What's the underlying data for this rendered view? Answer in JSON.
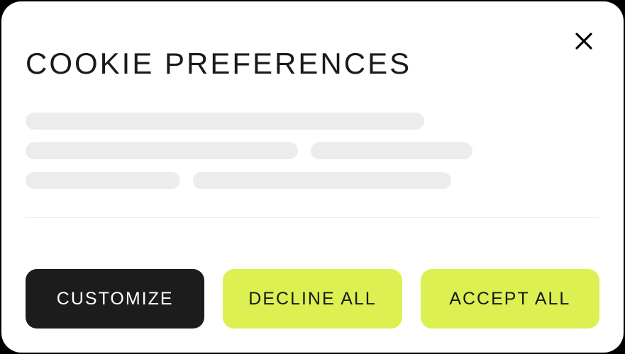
{
  "dialog": {
    "title": "COOKIE PREFERENCES",
    "buttons": {
      "customize": "CUSTOMIZE",
      "decline": "DECLINE ALL",
      "accept": "ACCEPT ALL"
    }
  }
}
